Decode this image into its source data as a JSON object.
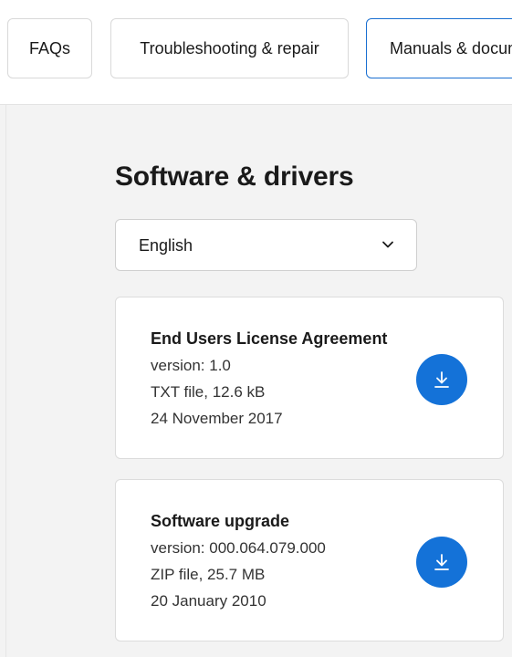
{
  "tabs": [
    {
      "label": "FAQs",
      "active": false
    },
    {
      "label": "Troubleshooting & repair",
      "active": false
    },
    {
      "label": "Manuals & documents",
      "active": true
    }
  ],
  "section": {
    "title": "Software & drivers"
  },
  "language_select": {
    "value": "English",
    "icon": "chevron-down-icon"
  },
  "downloads": [
    {
      "title": "End Users License Agreement",
      "version": "version: 1.0",
      "file": "TXT file, 12.6 kB",
      "date": "24 November 2017",
      "icon": "download-icon"
    },
    {
      "title": "Software upgrade",
      "version": "version: 000.064.079.000",
      "file": "ZIP file, 25.7 MB",
      "date": "20 January 2010",
      "icon": "download-icon"
    }
  ],
  "colors": {
    "accent": "#1472d8",
    "active_tab_border": "#1a6fd1",
    "page_background": "#f3f3f3"
  }
}
